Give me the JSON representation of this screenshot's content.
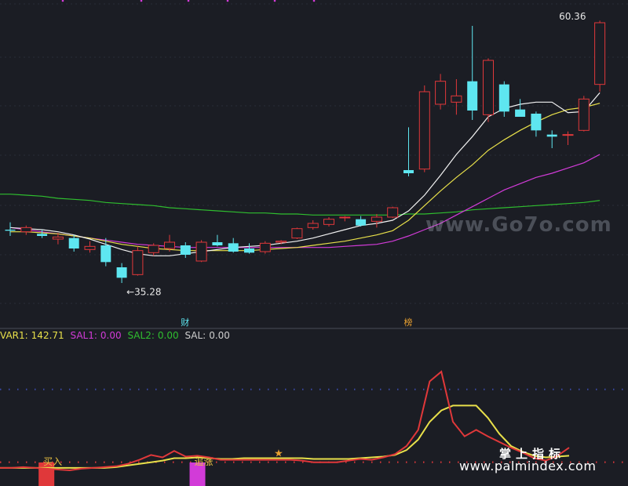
{
  "colors": {
    "background": "#1b1d24",
    "up": "#e0383a",
    "down": "#5ee6f0",
    "ma_white": "#f2f2f2",
    "ma_yellow": "#e8e04a",
    "ma_magenta": "#d23bd8",
    "ma_green": "#2fbf2f",
    "grid": "#3a4aa8"
  },
  "chart_data": [
    {
      "type": "candlestick",
      "ylim": [
        32,
        62
      ],
      "candles": [
        {
          "o": 40.4,
          "h": 41.1,
          "l": 39.8,
          "c": 40.3
        },
        {
          "o": 40.2,
          "h": 40.8,
          "l": 39.9,
          "c": 40.6
        },
        {
          "o": 40.0,
          "h": 40.4,
          "l": 39.6,
          "c": 39.8
        },
        {
          "o": 39.5,
          "h": 40.1,
          "l": 39.0,
          "c": 39.7
        },
        {
          "o": 39.6,
          "h": 39.9,
          "l": 38.3,
          "c": 38.6
        },
        {
          "o": 38.5,
          "h": 39.3,
          "l": 38.2,
          "c": 38.8
        },
        {
          "o": 38.9,
          "h": 39.6,
          "l": 36.9,
          "c": 37.3
        },
        {
          "o": 36.8,
          "h": 37.2,
          "l": 35.3,
          "c": 35.8
        },
        {
          "o": 36.1,
          "h": 38.8,
          "l": 36.0,
          "c": 38.4
        },
        {
          "o": 38.2,
          "h": 39.1,
          "l": 37.9,
          "c": 38.9
        },
        {
          "o": 38.6,
          "h": 39.9,
          "l": 38.3,
          "c": 39.2
        },
        {
          "o": 38.9,
          "h": 39.2,
          "l": 37.7,
          "c": 38.0
        },
        {
          "o": 37.4,
          "h": 39.4,
          "l": 37.3,
          "c": 39.2
        },
        {
          "o": 39.2,
          "h": 39.9,
          "l": 38.8,
          "c": 38.9
        },
        {
          "o": 39.1,
          "h": 39.6,
          "l": 38.2,
          "c": 38.3
        },
        {
          "o": 38.6,
          "h": 39.1,
          "l": 38.1,
          "c": 38.2
        },
        {
          "o": 38.3,
          "h": 39.3,
          "l": 38.1,
          "c": 39.1
        },
        {
          "o": 39.2,
          "h": 39.4,
          "l": 39.0,
          "c": 39.3
        },
        {
          "o": 39.6,
          "h": 40.6,
          "l": 39.5,
          "c": 40.5
        },
        {
          "o": 40.6,
          "h": 41.3,
          "l": 40.4,
          "c": 41.0
        },
        {
          "o": 40.9,
          "h": 41.6,
          "l": 40.7,
          "c": 41.4
        },
        {
          "o": 41.6,
          "h": 41.7,
          "l": 41.2,
          "c": 41.6
        },
        {
          "o": 41.4,
          "h": 41.7,
          "l": 40.7,
          "c": 40.8
        },
        {
          "o": 41.2,
          "h": 41.9,
          "l": 40.6,
          "c": 41.6
        },
        {
          "o": 41.6,
          "h": 42.6,
          "l": 41.5,
          "c": 42.5
        },
        {
          "o": 46.1,
          "h": 50.2,
          "l": 45.5,
          "c": 45.8
        },
        {
          "o": 46.2,
          "h": 54.2,
          "l": 45.9,
          "c": 53.6
        },
        {
          "o": 52.4,
          "h": 55.3,
          "l": 51.9,
          "c": 54.6
        },
        {
          "o": 52.6,
          "h": 54.8,
          "l": 51.4,
          "c": 53.2
        },
        {
          "o": 54.6,
          "h": 59.9,
          "l": 50.9,
          "c": 51.8
        },
        {
          "o": 51.4,
          "h": 56.8,
          "l": 50.7,
          "c": 56.6
        },
        {
          "o": 54.3,
          "h": 54.6,
          "l": 51.2,
          "c": 51.7
        },
        {
          "o": 51.9,
          "h": 52.9,
          "l": 51.2,
          "c": 51.2
        },
        {
          "o": 51.5,
          "h": 51.7,
          "l": 49.3,
          "c": 49.9
        },
        {
          "o": 49.5,
          "h": 49.9,
          "l": 48.2,
          "c": 49.3
        },
        {
          "o": 49.5,
          "h": 49.8,
          "l": 48.5,
          "c": 49.5
        },
        {
          "o": 49.9,
          "h": 53.2,
          "l": 49.8,
          "c": 52.9
        },
        {
          "o": 54.3,
          "h": 60.4,
          "l": 53.6,
          "c": 60.2
        }
      ],
      "ma_white": [
        40.6,
        40.5,
        40.4,
        40.2,
        39.9,
        39.5,
        39.0,
        38.5,
        38.1,
        37.9,
        37.9,
        38.1,
        38.3,
        38.5,
        38.7,
        38.8,
        38.9,
        39.1,
        39.3,
        39.6,
        40.0,
        40.4,
        40.8,
        41.0,
        41.3,
        42.2,
        43.7,
        45.6,
        47.6,
        49.3,
        51.2,
        52.0,
        52.4,
        52.6,
        52.6,
        51.6,
        51.7,
        53.5
      ],
      "ma_yellow": [
        40.2,
        40.2,
        40.1,
        40.0,
        39.8,
        39.6,
        39.3,
        39.0,
        38.8,
        38.6,
        38.5,
        38.4,
        38.4,
        38.4,
        38.4,
        38.4,
        38.5,
        38.6,
        38.7,
        38.9,
        39.1,
        39.3,
        39.6,
        39.9,
        40.3,
        41.3,
        42.7,
        44.1,
        45.4,
        46.6,
        48.0,
        49.0,
        49.9,
        50.7,
        51.4,
        51.9,
        52.1,
        52.5
      ],
      "ma_magenta": [
        40.6,
        40.4,
        40.2,
        40.0,
        39.8,
        39.6,
        39.4,
        39.2,
        39.0,
        38.9,
        38.8,
        38.7,
        38.7,
        38.7,
        38.7,
        38.7,
        38.7,
        38.7,
        38.7,
        38.7,
        38.7,
        38.8,
        38.9,
        39.0,
        39.3,
        39.8,
        40.4,
        41.0,
        41.8,
        42.6,
        43.4,
        44.2,
        44.8,
        45.4,
        45.8,
        46.3,
        46.8,
        47.6
      ],
      "ma_green": [
        43.8,
        43.7,
        43.6,
        43.4,
        43.3,
        43.2,
        43.0,
        42.9,
        42.8,
        42.7,
        42.5,
        42.4,
        42.3,
        42.2,
        42.1,
        42.0,
        42.0,
        41.9,
        41.9,
        41.8,
        41.8,
        41.8,
        41.8,
        41.8,
        41.8,
        41.9,
        41.9,
        42.0,
        42.1,
        42.3,
        42.4,
        42.5,
        42.6,
        42.7,
        42.8,
        42.9,
        43.0,
        43.2
      ],
      "annotations": [
        {
          "text": "←35.28",
          "index": 7,
          "value": 35.28
        },
        {
          "text": "60.36",
          "index": 37,
          "value": 60.36
        }
      ],
      "markers": [
        {
          "text": "财",
          "index": 11
        },
        {
          "text": "榜",
          "index": 25
        }
      ]
    },
    {
      "type": "line",
      "ylim": [
        0,
        155
      ],
      "legend": [
        {
          "name": "VAR1:",
          "value": "142.71",
          "color": "#e8e04a"
        },
        {
          "name": "SAL1:",
          "value": "0.00",
          "color": "#d23bd8"
        },
        {
          "name": "SAL2:",
          "value": "0.00",
          "color": "#2fbf2f"
        },
        {
          "name": "SAL:",
          "value": "0.00",
          "color": "#cfcfcf"
        }
      ],
      "reference_lines": [
        {
          "value": 100,
          "color": "#3a4aa8"
        },
        {
          "value": 10,
          "color": "#e0383a"
        }
      ],
      "series_red": [
        3,
        3,
        4,
        3,
        2,
        1,
        0,
        2,
        3,
        4,
        5,
        8,
        13,
        19,
        16,
        24,
        17,
        18,
        16,
        13,
        13,
        13,
        13,
        13,
        13,
        13,
        12,
        10,
        10,
        10,
        12,
        14,
        13,
        16,
        20,
        30,
        50,
        110,
        122,
        60,
        42,
        50,
        42,
        35,
        28,
        22,
        15,
        12,
        18,
        28
      ],
      "series_yellow": [
        3,
        3,
        3,
        3,
        3,
        3,
        3,
        3,
        3,
        3,
        4,
        6,
        8,
        10,
        12,
        15,
        15,
        16,
        15,
        14,
        14,
        15,
        15,
        15,
        15,
        15,
        15,
        14,
        14,
        14,
        14,
        15,
        16,
        17,
        19,
        25,
        38,
        60,
        74,
        80,
        80,
        80,
        65,
        45,
        30,
        23,
        18,
        16,
        17,
        18
      ],
      "signals": [
        {
          "text": "买入",
          "index": 4,
          "color": "#e0383a"
        },
        {
          "text": "追涨",
          "index": 17,
          "color": "#d23bd8"
        }
      ],
      "star_index": 24
    }
  ],
  "watermarks": {
    "overlay": "www.Go7o.com",
    "brand": "掌上指标",
    "url": "www.palmindex.com"
  }
}
